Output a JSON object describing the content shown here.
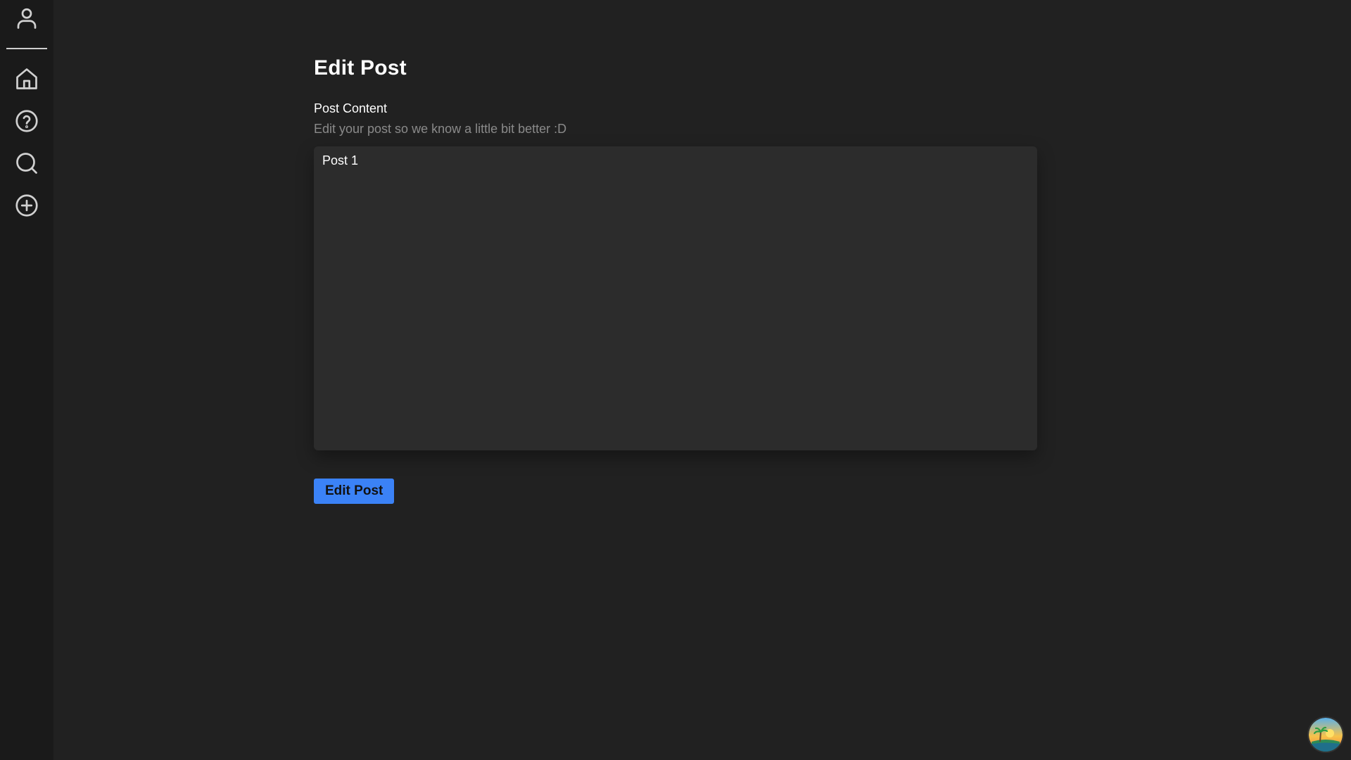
{
  "colors": {
    "page_bg": "#212121",
    "sidebar_bg": "#1a1a1a",
    "accent": "#3b82f6",
    "textarea_bg": "#2c2c2c",
    "hint_text": "#8a8a8a"
  },
  "sidebar": {
    "profile_icon": "user-icon",
    "items": [
      {
        "icon": "home-icon",
        "label": "Home"
      },
      {
        "icon": "help-icon",
        "label": "Help"
      },
      {
        "icon": "search-icon",
        "label": "Search"
      },
      {
        "icon": "add-circle-icon",
        "label": "Create"
      }
    ]
  },
  "main": {
    "title": "Edit Post",
    "field": {
      "label": "Post Content",
      "hint": "Edit your post so we know a little bit better :D",
      "value": "Post 1"
    },
    "submit_label": "Edit Post"
  },
  "floating_avatar": {
    "icon": "island-sunset-avatar"
  }
}
